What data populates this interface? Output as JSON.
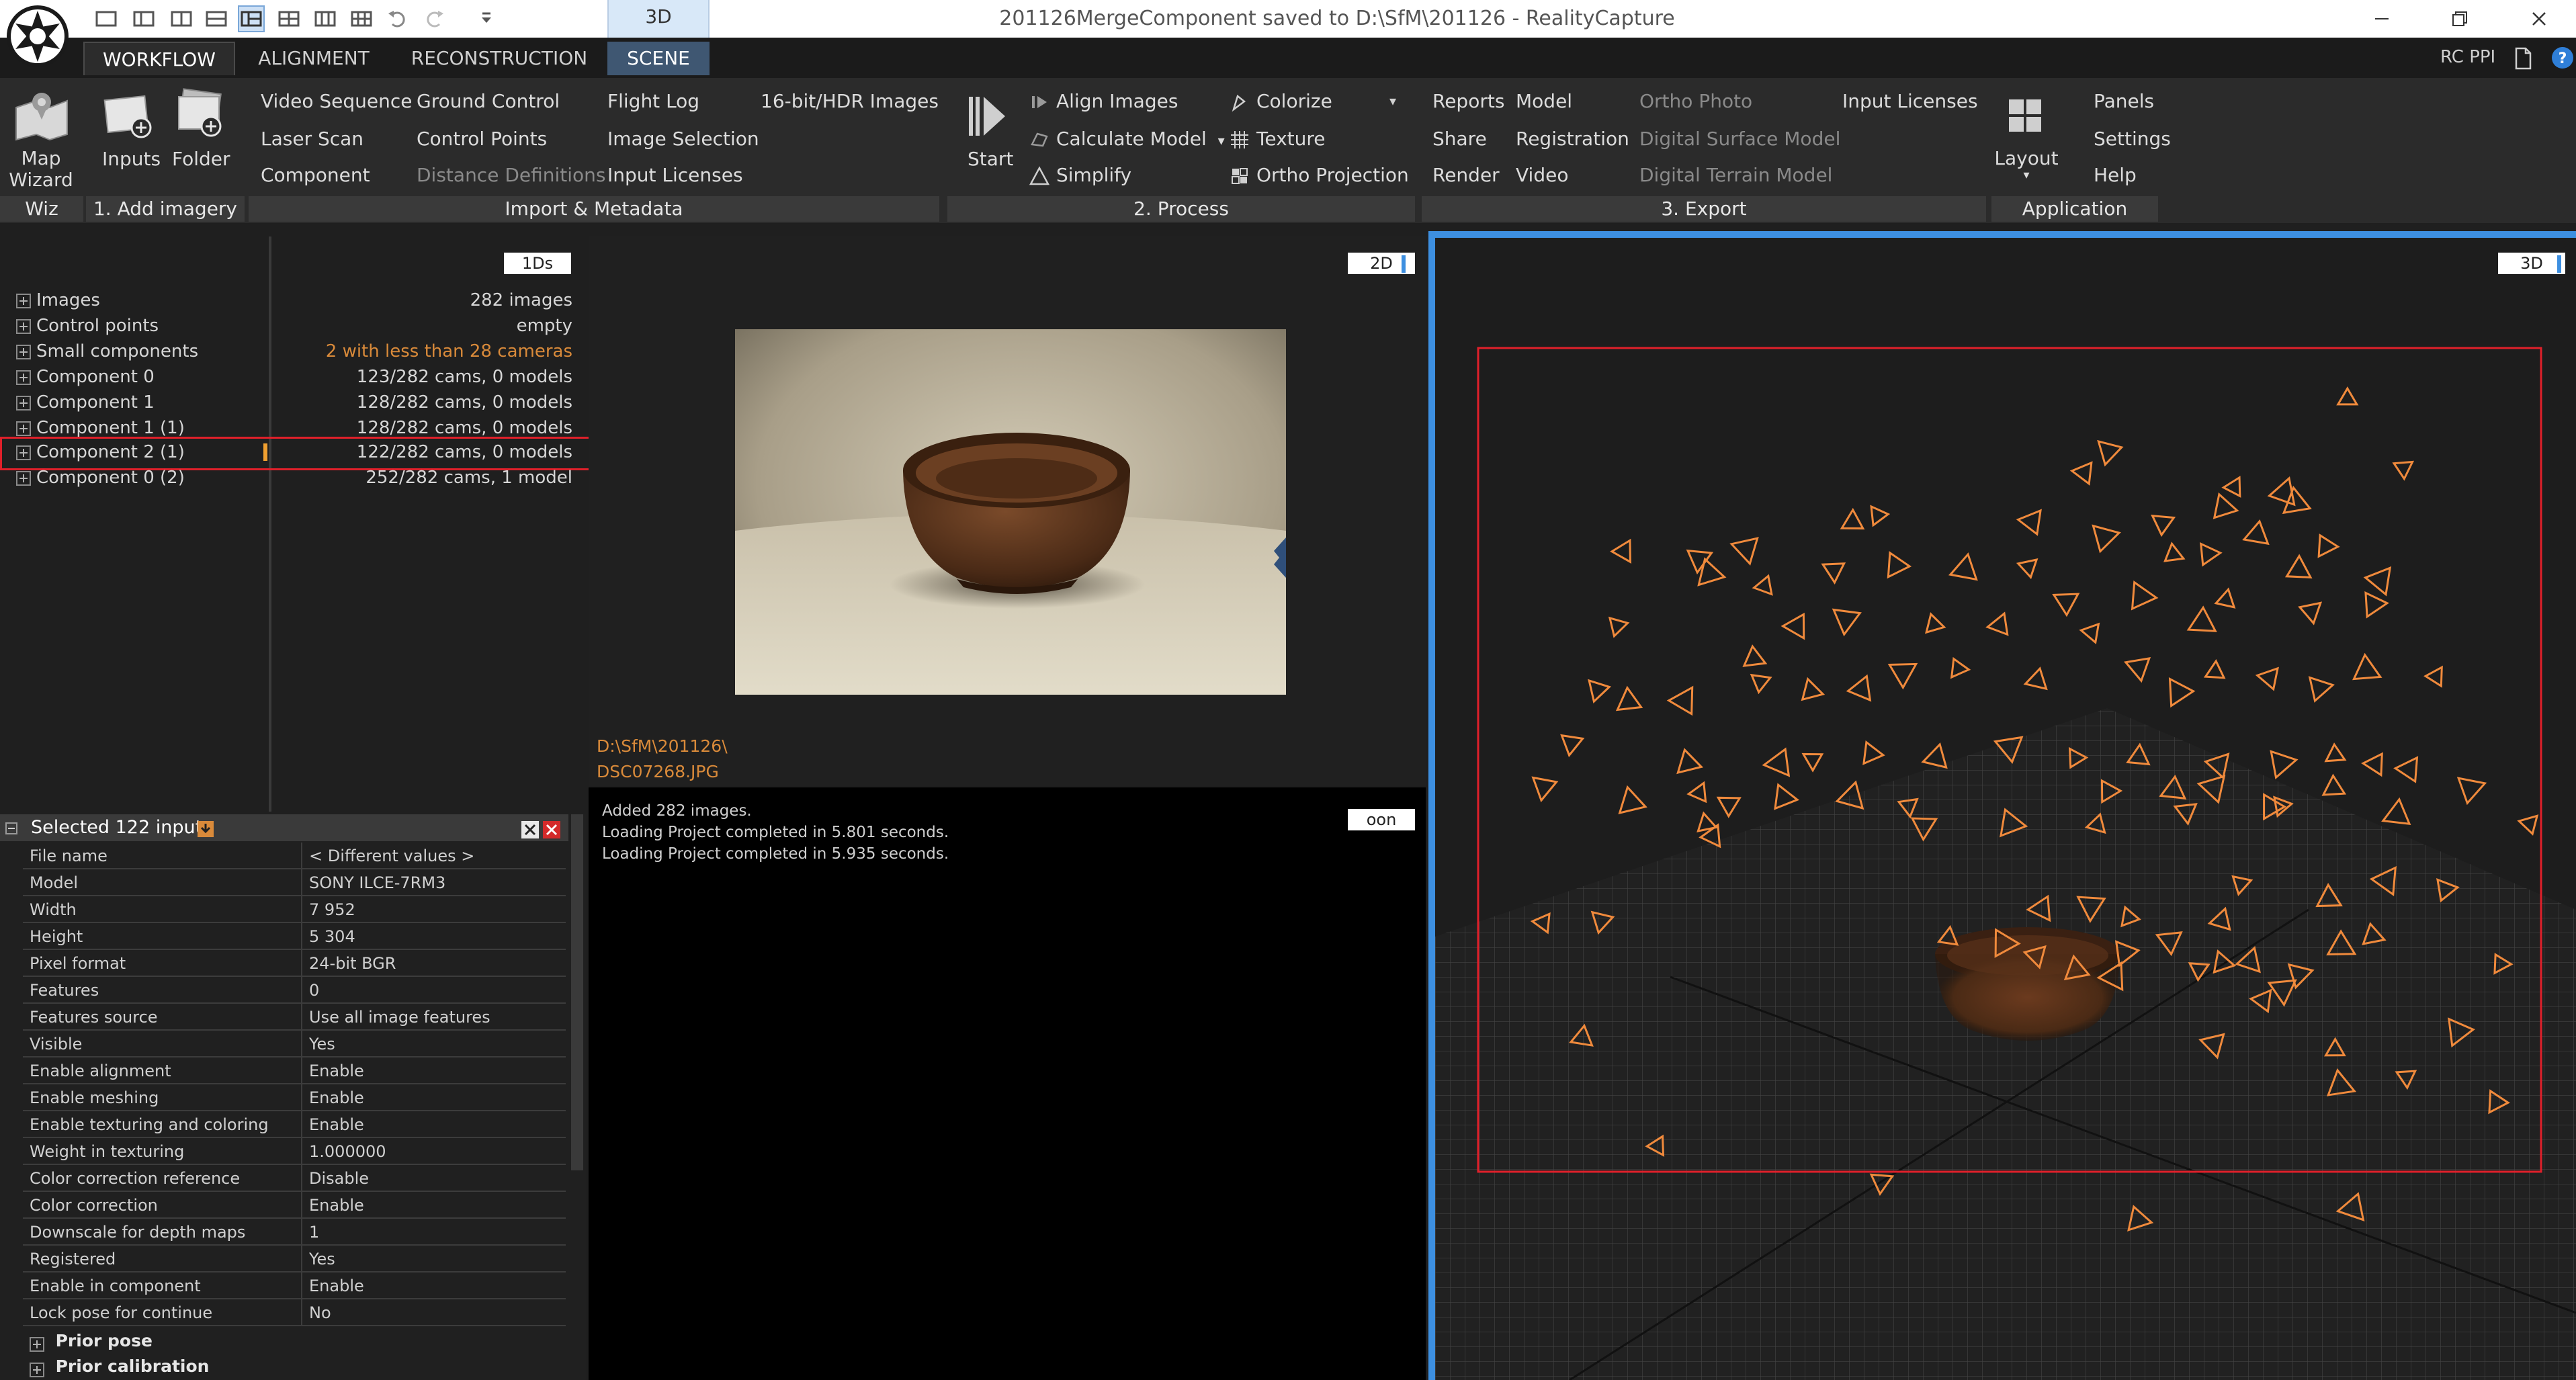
{
  "window": {
    "title": "201126MergeComponent saved to D:\\SfM\\201126 - RealityCapture",
    "view_tab": "3D"
  },
  "tabs": [
    {
      "label": "WORKFLOW",
      "state": "active"
    },
    {
      "label": "ALIGNMENT"
    },
    {
      "label": "RECONSTRUCTION"
    },
    {
      "label": "SCENE"
    }
  ],
  "top_right": {
    "ppi_label": "RC PPI"
  },
  "ribbon": {
    "wiz": {
      "map_wizard": "Map Wizard",
      "map": "Map",
      "wizard": "Wizard"
    },
    "add_imagery": {
      "inputs": "Inputs",
      "folder": "Folder"
    },
    "import_metadata": {
      "video_sequence": "Video Sequence",
      "laser_scan": "Laser Scan",
      "component": "Component",
      "ground_control": "Ground Control",
      "control_points": "Control Points",
      "distance_definitions": "Distance Definitions",
      "flight_log": "Flight Log",
      "image_selection": "Image Selection",
      "input_licenses": "Input Licenses",
      "hdr_images": "16-bit/HDR Images"
    },
    "process": {
      "start": "Start",
      "align_images": "Align Images",
      "calculate_model": "Calculate Model",
      "simplify": "Simplify",
      "colorize": "Colorize",
      "texture": "Texture",
      "ortho_projection": "Ortho Projection"
    },
    "export": {
      "reports": "Reports",
      "share": "Share",
      "render": "Render",
      "model": "Model",
      "registration": "Registration",
      "video": "Video",
      "ortho_photo": "Ortho Photo",
      "digital_surface_model": "Digital Surface Model",
      "digital_terrain_model": "Digital Terrain Model",
      "input_licenses": "Input Licenses"
    },
    "application": {
      "layout": "Layout",
      "panels": "Panels",
      "settings": "Settings",
      "help": "Help"
    },
    "groups": {
      "wiz": "Wiz",
      "add_imagery": "1. Add imagery",
      "import_metadata": "Import & Metadata",
      "process": "2. Process",
      "export": "3. Export",
      "application": "Application"
    }
  },
  "tree_panel": {
    "badge": "1Ds",
    "rows": [
      {
        "label": "Images",
        "value": "282 images"
      },
      {
        "label": "Control points",
        "value": "empty"
      },
      {
        "label": "Small components",
        "value": "2 with less than 28 cameras",
        "warning": true
      },
      {
        "label": "Component 0",
        "value": "123/282 cams, 0 models"
      },
      {
        "label": "Component 1",
        "value": "128/282 cams, 0 models"
      },
      {
        "label": "Component 1 (1)",
        "value": "128/282 cams, 0 models"
      },
      {
        "label": "Component 2 (1)",
        "value": "122/282 cams, 0 models",
        "highlighted": true
      },
      {
        "label": "Component 0 (2)",
        "value": "252/282 cams, 1 model"
      }
    ]
  },
  "image_view": {
    "badge": "2D",
    "path_line1": "D:\\SfM\\201126\\",
    "path_line2": "DSC07268.JPG"
  },
  "log_panel": {
    "badge": "oon",
    "lines": [
      "Added 282 images.",
      "Loading Project completed in 5.801 seconds.",
      "Loading Project completed in 5.935 seconds."
    ]
  },
  "scene_view": {
    "badge": "3D"
  },
  "inspector": {
    "title": "Selected 122 inputs",
    "rows": [
      {
        "key": "File name",
        "value": "< Different values >"
      },
      {
        "key": "Model",
        "value": "SONY ILCE-7RM3"
      },
      {
        "key": "Width",
        "value": "7 952"
      },
      {
        "key": "Height",
        "value": "5 304"
      },
      {
        "key": "Pixel format",
        "value": "24-bit BGR"
      },
      {
        "key": "Features",
        "value": "0"
      },
      {
        "key": "Features source",
        "value": "Use all image features"
      },
      {
        "key": "Visible",
        "value": "Yes"
      },
      {
        "key": "Enable alignment",
        "value": "Enable"
      },
      {
        "key": "Enable meshing",
        "value": "Enable"
      },
      {
        "key": "Enable texturing and coloring",
        "value": "Enable"
      },
      {
        "key": "Weight in texturing",
        "value": "1.000000"
      },
      {
        "key": "Color correction reference",
        "value": "Disable"
      },
      {
        "key": "Color correction",
        "value": "Enable"
      },
      {
        "key": "Downscale for depth maps",
        "value": "1"
      },
      {
        "key": "Registered",
        "value": "Yes"
      },
      {
        "key": "Enable in component",
        "value": "Enable"
      },
      {
        "key": "Lock pose for continue",
        "value": "No"
      }
    ],
    "sections": [
      "Prior pose",
      "Prior calibration"
    ]
  },
  "colors": {
    "accent_blue": "#3d8fe0",
    "highlight_red": "#e0202a",
    "camera_orange": "#f08a3c",
    "warning_orange": "#d98a3a"
  }
}
